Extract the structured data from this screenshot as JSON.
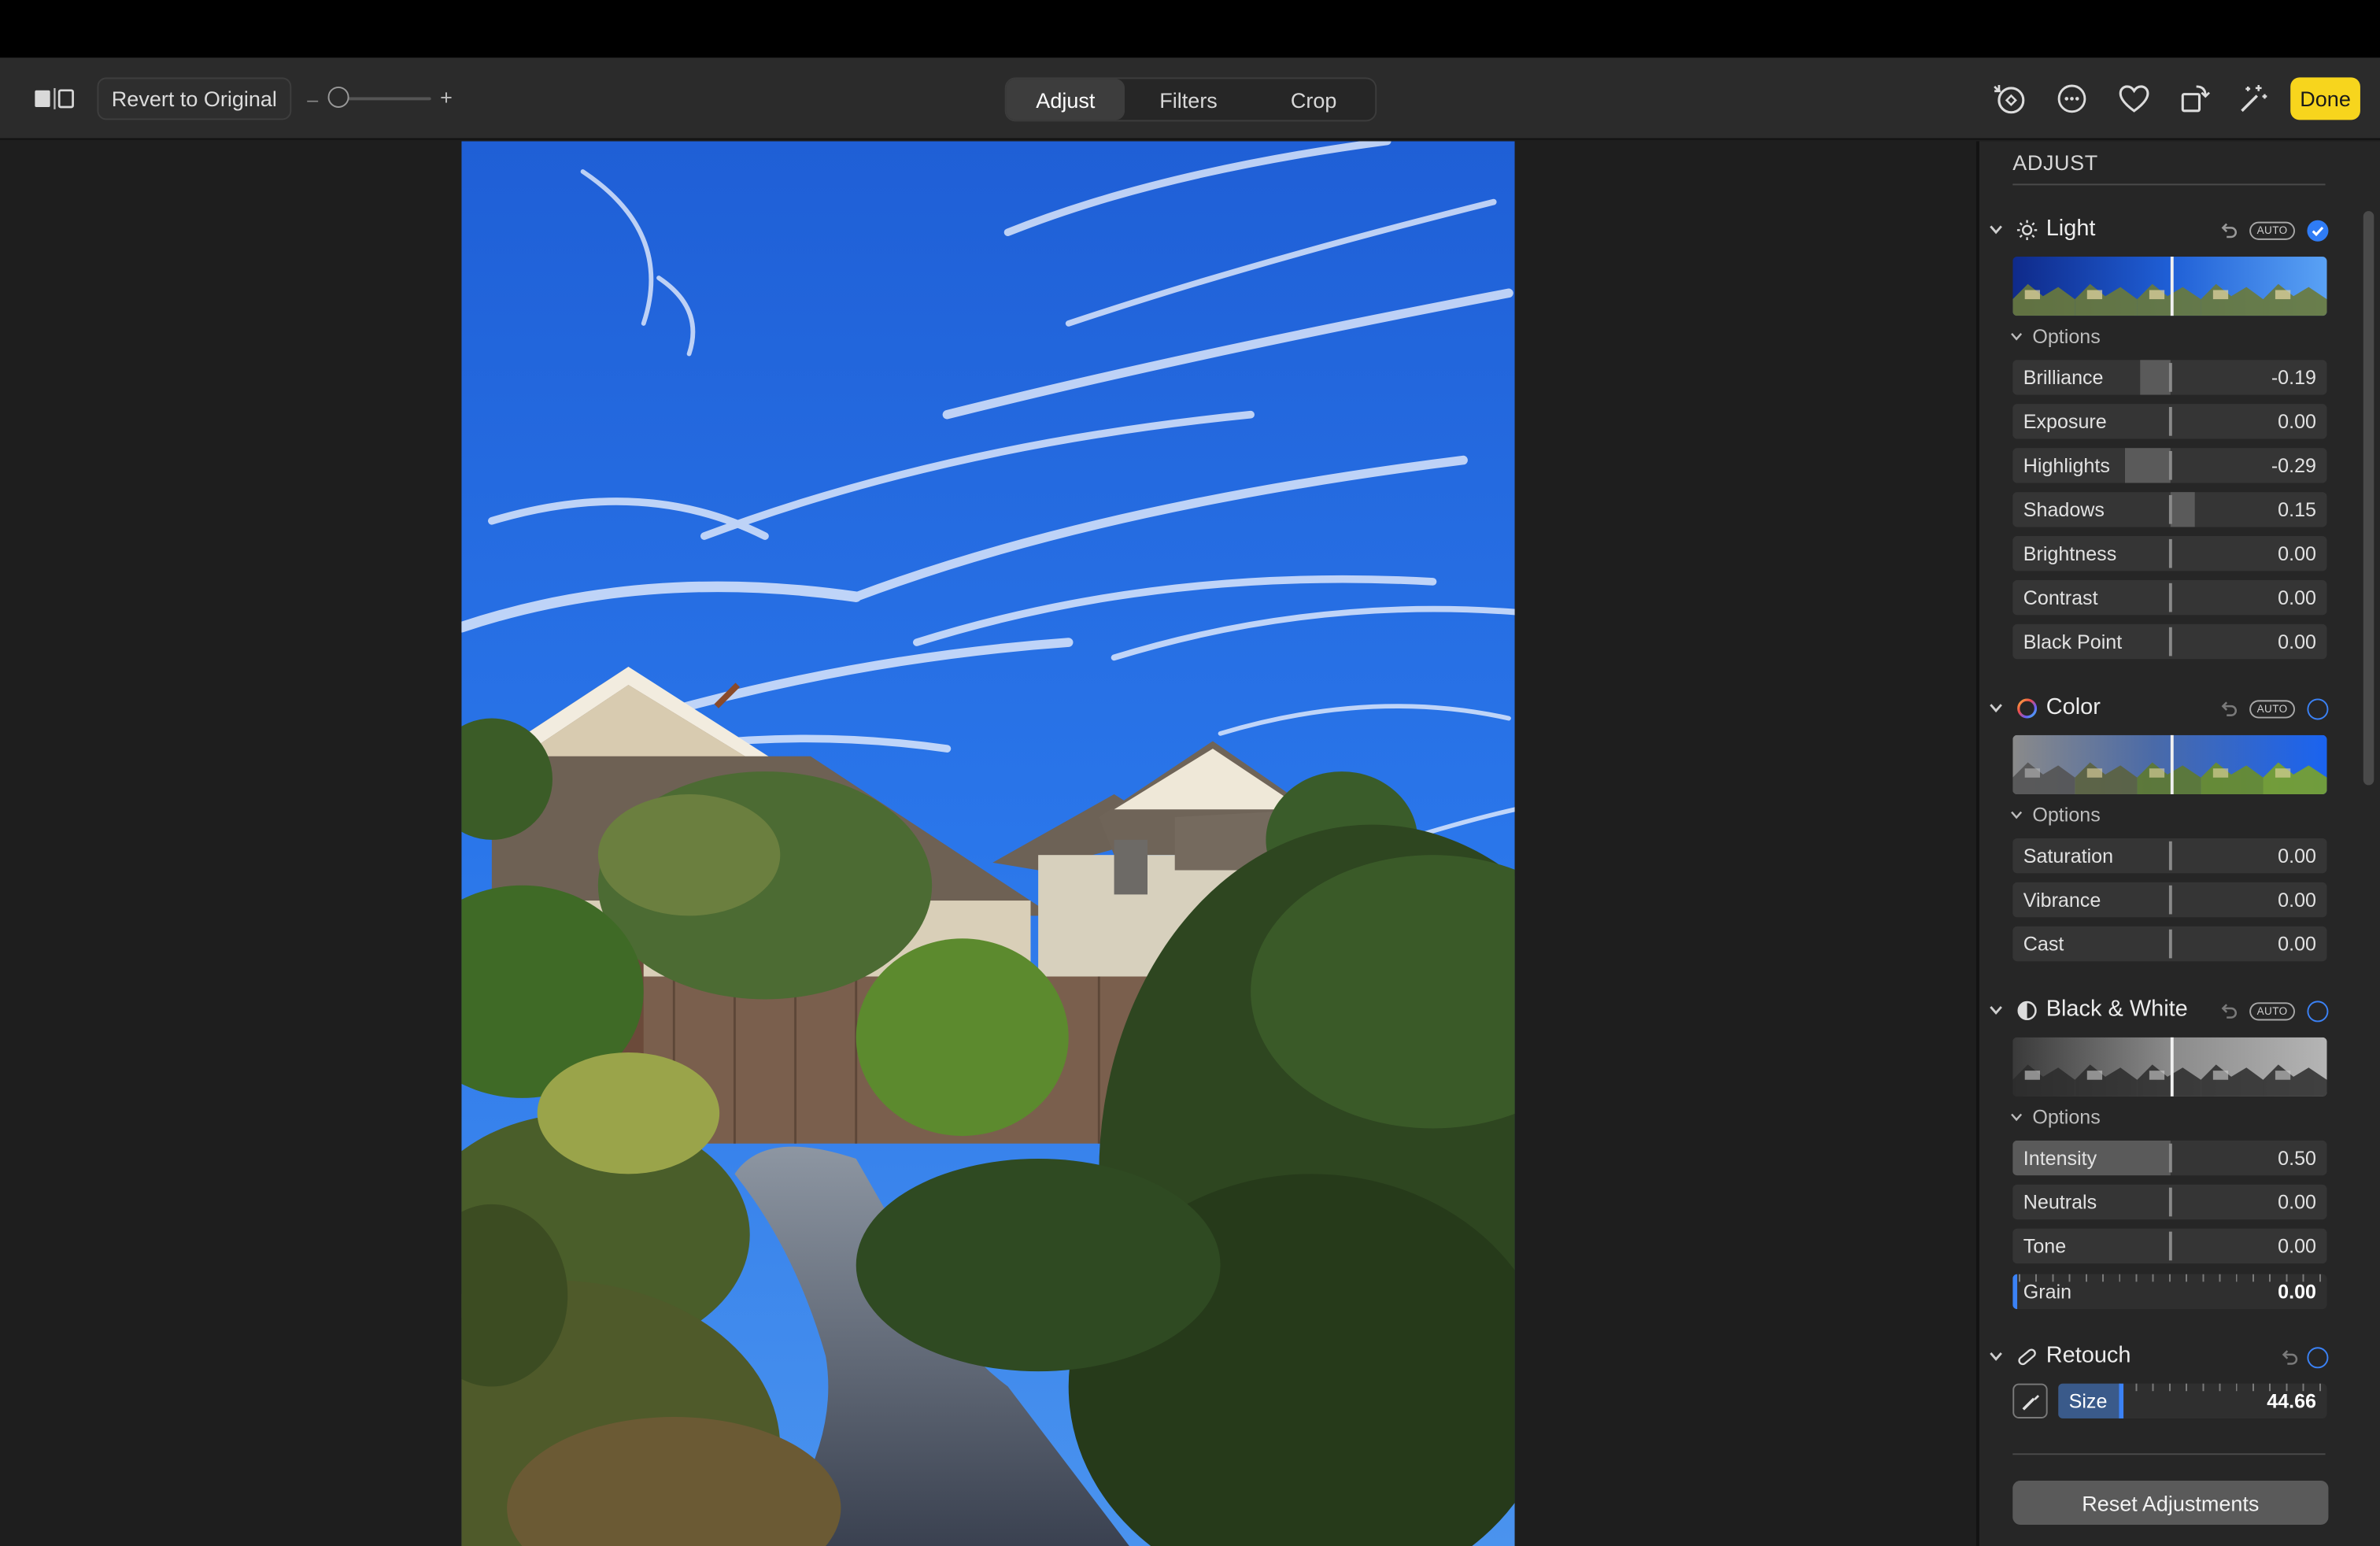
{
  "toolbar": {
    "revert_label": "Revert to Original",
    "zoom_minus": "–",
    "zoom_plus": "+",
    "tabs": [
      {
        "label": "Adjust",
        "active": true
      },
      {
        "label": "Filters",
        "active": false
      },
      {
        "label": "Crop",
        "active": false
      }
    ],
    "icons": [
      "info-edit-icon",
      "more-icon",
      "favorite-heart-icon",
      "rotate-icon",
      "auto-enhance-icon"
    ],
    "done_label": "Done",
    "done_color": "#f7d51d"
  },
  "sidebar": {
    "title": "ADJUST",
    "auto_label": "AUTO",
    "options_label": "Options",
    "accent_color": "#3b82f6",
    "light": {
      "title": "Light",
      "enabled": true,
      "sliders": [
        {
          "label": "Brilliance",
          "value": "-0.19",
          "amount": -0.19
        },
        {
          "label": "Exposure",
          "value": "0.00",
          "amount": 0
        },
        {
          "label": "Highlights",
          "value": "-0.29",
          "amount": -0.29
        },
        {
          "label": "Shadows",
          "value": "0.15",
          "amount": 0.15
        },
        {
          "label": "Brightness",
          "value": "0.00",
          "amount": 0
        },
        {
          "label": "Contrast",
          "value": "0.00",
          "amount": 0
        },
        {
          "label": "Black Point",
          "value": "0.00",
          "amount": 0
        }
      ]
    },
    "color": {
      "title": "Color",
      "enabled": false,
      "sliders": [
        {
          "label": "Saturation",
          "value": "0.00",
          "amount": 0
        },
        {
          "label": "Vibrance",
          "value": "0.00",
          "amount": 0
        },
        {
          "label": "Cast",
          "value": "0.00",
          "amount": 0
        }
      ]
    },
    "bw": {
      "title": "Black & White",
      "enabled": false,
      "sliders": [
        {
          "label": "Intensity",
          "value": "0.50",
          "amount": 0.5
        },
        {
          "label": "Neutrals",
          "value": "0.00",
          "amount": 0
        },
        {
          "label": "Tone",
          "value": "0.00",
          "amount": 0
        }
      ],
      "grain": {
        "label": "Grain",
        "value": "0.00"
      }
    },
    "retouch": {
      "title": "Retouch",
      "enabled": false,
      "size_label": "Size",
      "size_value": "44.66",
      "size_fraction": 0.25
    },
    "reset_label": "Reset Adjustments"
  }
}
